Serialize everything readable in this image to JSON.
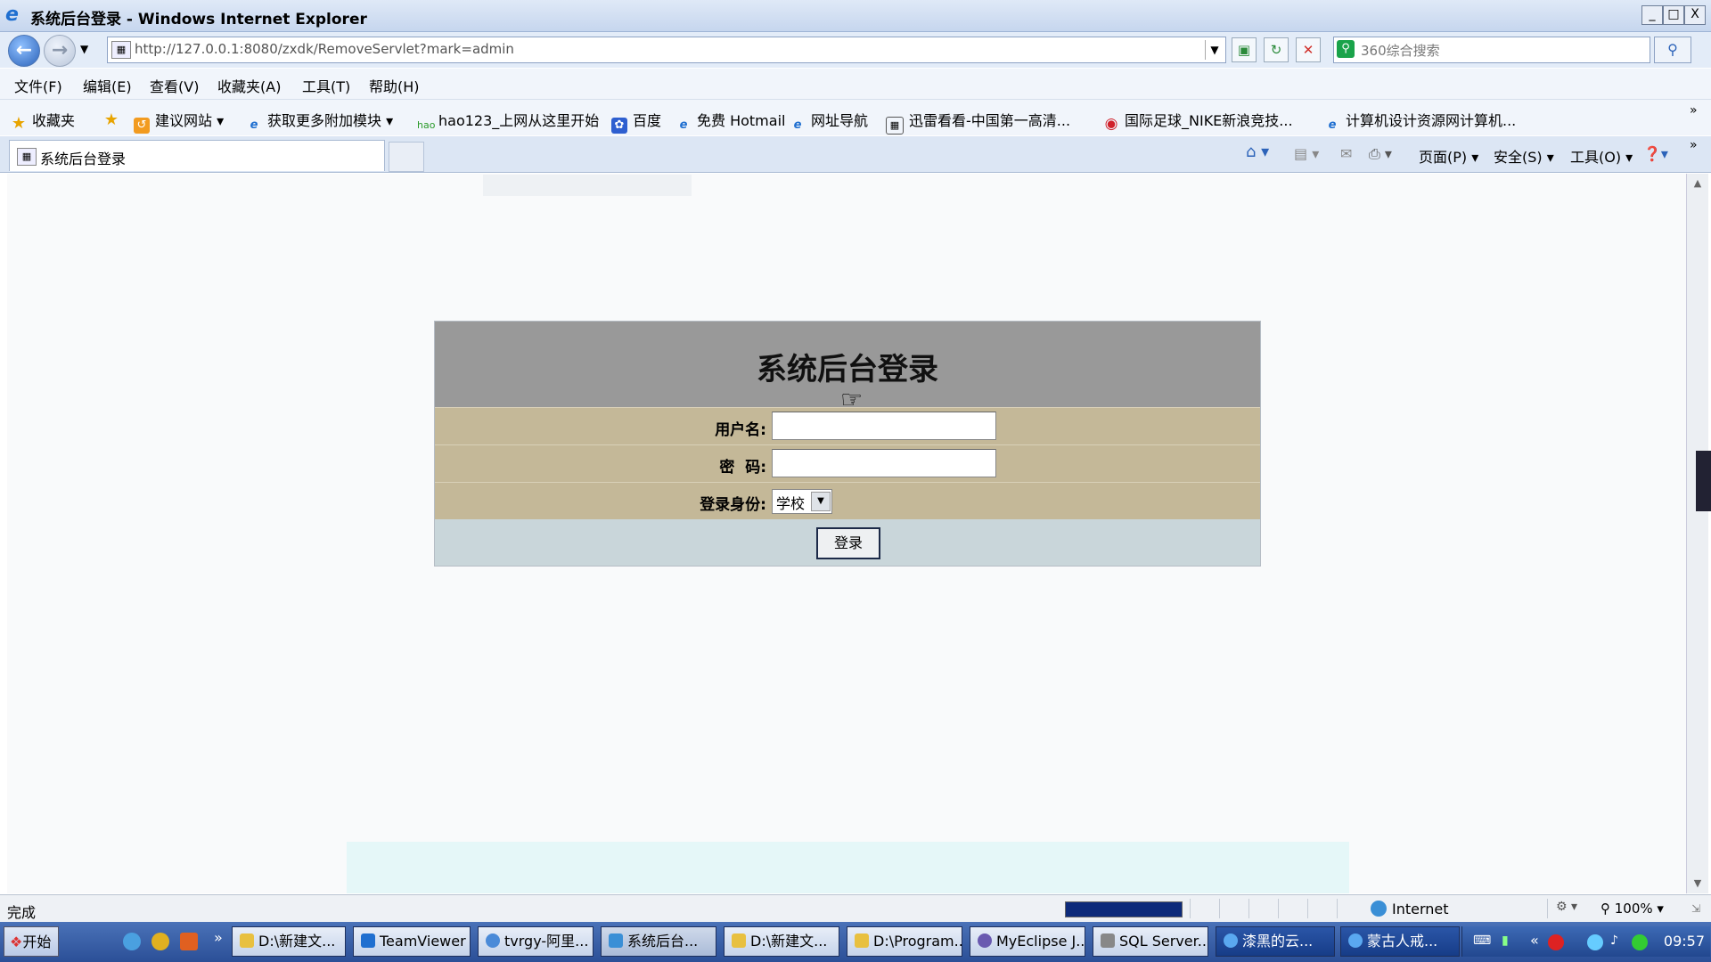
{
  "window": {
    "title": "系统后台登录 - Windows Internet Explorer",
    "buttons": [
      "_",
      "□",
      "X"
    ]
  },
  "nav": {
    "url": "http://127.0.0.1:8080/zxdk/RemoveServlet?mark=admin",
    "search_placeholder": "360综合搜索"
  },
  "menubar": [
    "文件(F)",
    "编辑(E)",
    "查看(V)",
    "收藏夹(A)",
    "工具(T)",
    "帮助(H)"
  ],
  "favorites": {
    "label": "收藏夹",
    "items": [
      "建议网站 ▾",
      "获取更多附加模块 ▾",
      "hao123_上网从这里开始",
      "百度",
      "免费 Hotmail",
      "网址导航",
      "迅雷看看-中国第一高清...",
      "国际足球_NIKE新浪竞技...",
      "计算机设计资源网计算机..."
    ]
  },
  "tab": {
    "label": "系统后台登录"
  },
  "command_bar": [
    "页面(P) ▾",
    "安全(S) ▾",
    "工具(O) ▾"
  ],
  "login": {
    "title": "系统后台登录",
    "username_label": "用户名:",
    "username_value": "",
    "password_label": "密  码:",
    "password_value": "",
    "role_label": "登录身份:",
    "role_selected": "学校",
    "submit_label": "登录"
  },
  "status": {
    "text": "完成",
    "zone": "Internet",
    "zoom": "100%"
  },
  "taskbar": {
    "start": "开始",
    "tasks": [
      "D:\\新建文...",
      "TeamViewer",
      "tvrgy-阿里...",
      "系统后台...",
      "D:\\新建文...",
      "D:\\Program...",
      "MyEclipse J...",
      "SQL Server...",
      "漆黑的云...",
      "蒙古人戒..."
    ],
    "clock": "09:57"
  }
}
